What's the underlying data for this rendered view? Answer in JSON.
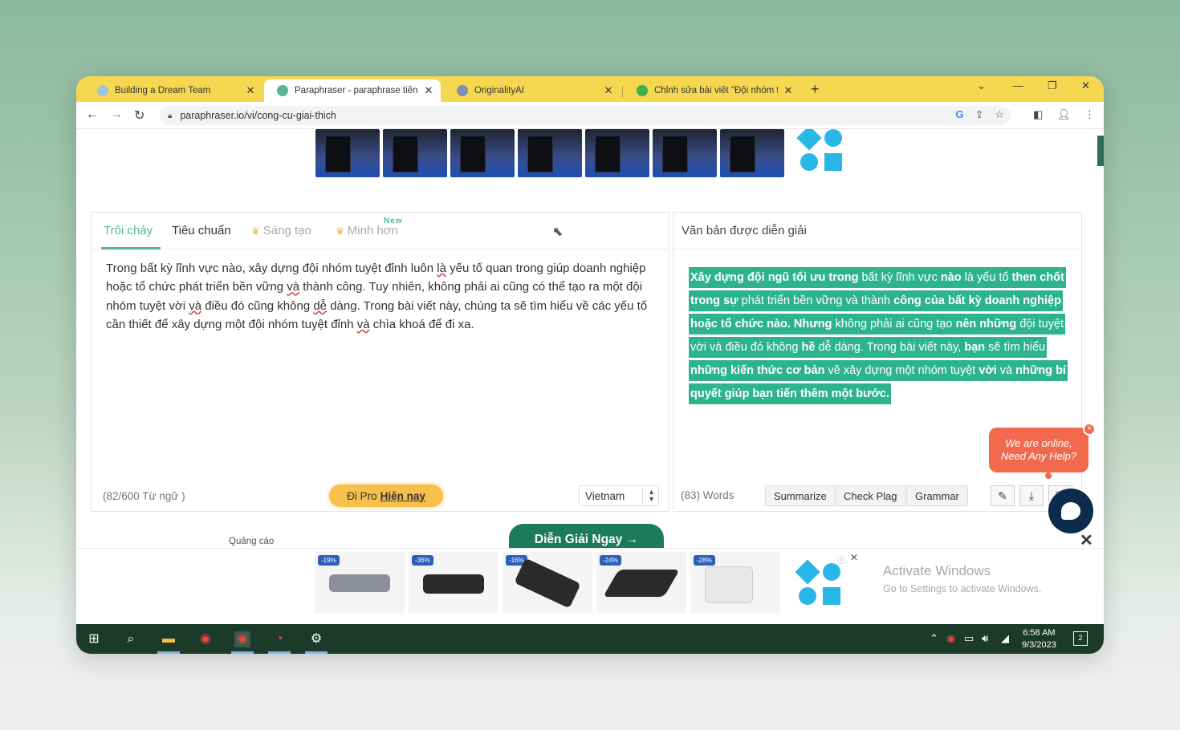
{
  "browser": {
    "tabs": [
      {
        "title": "Building a Dream Team",
        "favicon_color": "#9fc5d8"
      },
      {
        "title": "Paraphraser - paraphrase tiếng v",
        "favicon_color": "#55b89a"
      },
      {
        "title": "OriginalityAI",
        "favicon_color": "#7a8fb3"
      },
      {
        "title": "Chỉnh sửa bài viết \"Đội nhóm tu",
        "favicon_color": "#3bb24a"
      }
    ],
    "new_tab": "+",
    "url": "paraphraser.io/vi/cong-cu-giai-thich"
  },
  "modes": {
    "fluent": "Trôi chảy",
    "standard": "Tiêu chuẩn",
    "creative": "Sáng tạo",
    "smarter": "Minh hơn",
    "new_badge": "New"
  },
  "input": {
    "part1": "Trong bất kỳ lĩnh vực nào, xây dựng đội nhóm tuyệt đỉnh luôn ",
    "w1": "là",
    "part2": " yếu tố quan trong giúp doanh nghiệp hoặc tổ chức phát triển bền vững ",
    "w2": "và",
    "part3": " thành công. Tuy nhiên, không phải ai cũng có thể tạo ra một đội nhóm tuyệt vời ",
    "w3": "và",
    "part4": " điều đó cũng không ",
    "w4": "dễ",
    "part5": " dàng. Trong bài viết này, chúng ta sẽ tìm hiểu về các yếu tố cần thiết để xây dựng một đội nhóm tuyệt đỉnh ",
    "w5": "và",
    "part6": " chìa khoá để đi xa.",
    "word_count": "(82/600 Từ ngữ )",
    "pro_label": "Đi Pro",
    "pro_link": "Hiện nay",
    "language": "Vietnam"
  },
  "output": {
    "title": "Văn bản được diễn giải",
    "segments": [
      {
        "t": "Xây dựng đội ngũ tối ưu trong",
        "b": true
      },
      {
        "t": " bất kỳ lĩnh vực ",
        "b": false
      },
      {
        "t": "nào",
        "b": true
      },
      {
        "t": " là yếu tố ",
        "b": false
      },
      {
        "t": "then chốt trong sự",
        "b": true
      },
      {
        "t": " phát triển bền vững và thành ",
        "b": false
      },
      {
        "t": "công của bất kỳ doanh nghiệp hoặc tổ chức nào. Nhưng",
        "b": true
      },
      {
        "t": " không phải ai cũng tạo ",
        "b": false
      },
      {
        "t": "nên những",
        "b": true
      },
      {
        "t": " đội tuyệt vời và điều đó không ",
        "b": false
      },
      {
        "t": "hề",
        "b": true
      },
      {
        "t": " dễ dàng. Trong bài viết này, ",
        "b": false
      },
      {
        "t": "bạn",
        "b": true
      },
      {
        "t": " sẽ tìm hiểu ",
        "b": false
      },
      {
        "t": "những kiến thức cơ bản",
        "b": true
      },
      {
        "t": " về xây dựng một nhóm tuyệt ",
        "b": false
      },
      {
        "t": "vời",
        "b": true
      },
      {
        "t": " và ",
        "b": false
      },
      {
        "t": "những bí quyết giúp bạn tiến thêm một bước.",
        "b": true
      }
    ],
    "word_count": "(83) Words",
    "buttons": {
      "summarize": "Summarize",
      "check_plag": "Check Plag",
      "grammar": "Grammar"
    },
    "highlight_color": "#2db48e"
  },
  "chat": {
    "line1": "We are online,",
    "line2": "Need Any Help?",
    "close": "×"
  },
  "cta": {
    "label": "Diễn Giải Ngay →"
  },
  "ads": {
    "label": "Quảng cáo",
    "discounts": [
      "-19%",
      "-36%",
      "-16%",
      "-24%",
      "-28%"
    ]
  },
  "watermark": {
    "title": "Activate Windows",
    "subtitle": "Go to Settings to activate Windows."
  },
  "taskbar": {
    "time": "6:58 AM",
    "date": "9/3/2023",
    "notifications": "2"
  },
  "colors": {
    "accent": "#55b89a",
    "tabstrip": "#f6d850",
    "taskbar": "#1c3a2a"
  }
}
